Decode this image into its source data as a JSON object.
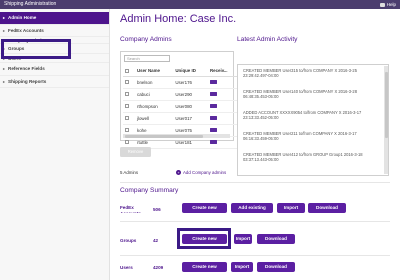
{
  "topbar": {
    "title": "Shipping Administration",
    "help": "Help"
  },
  "sidebar": {
    "items": [
      {
        "label": "Admin Home"
      },
      {
        "label": "FedEx Accounts"
      },
      {
        "label": "Company Admins"
      },
      {
        "label": "Groups"
      },
      {
        "label": "Users"
      },
      {
        "label": "Reference Fields"
      },
      {
        "label": "Shipping Reports"
      }
    ]
  },
  "page": {
    "title": "Admin Home: Case Inc."
  },
  "admins": {
    "heading": "Company Admins",
    "search_placeholder": "Search",
    "columns": [
      "User Name",
      "Unique ID",
      "Receiv..."
    ],
    "rows": [
      {
        "name": "bnelson",
        "id": "User176"
      },
      {
        "name": "cabuci",
        "id": "User290"
      },
      {
        "name": "rthompson",
        "id": "User080"
      },
      {
        "name": "jlowell",
        "id": "User017"
      },
      {
        "name": "kohe",
        "id": "User075"
      },
      {
        "name": "rtuttle",
        "id": "User181"
      }
    ],
    "remove_label": "Remove",
    "count_label": "5 Admins",
    "add_label": "Add Company admins"
  },
  "activity": {
    "heading": "Latest Admin Activity",
    "entries": [
      "CREATED MEMBER User315 to/from COMPANY X 2016-3-25 23:29:42.497-04:00",
      "CREATED MEMBER User140 to/from COMPANY X 2016-3-28 06:48:35.453-05:00",
      "ADDED ACCOUNT XXXXX9054 to/from COMPANY X 2016-3-17 23:13:33.452-05:00",
      "CREATED MEMBER User211 to/from COMPANY X 2016-3-17 06:16:33.459-05:00",
      "CREATED MEMBER User412 to/from GROUP Group1 2016-3-18 03:37:13.443-05:00"
    ]
  },
  "summary": {
    "heading": "Company Summary",
    "rows": [
      {
        "label": "FedEx Accounts",
        "count": "506",
        "buttons": [
          "Create new",
          "Add existing",
          "Import",
          "Download"
        ]
      },
      {
        "label": "Groups",
        "count": "42",
        "buttons": [
          "Create new",
          "Import",
          "Download"
        ]
      },
      {
        "label": "Users",
        "count": "4209",
        "buttons": [
          "Create new",
          "Import",
          "Download"
        ]
      }
    ]
  },
  "colors": {
    "brand_purple": "#4d148c",
    "button_purple": "#5b1fa2",
    "topbar": "#4b3d6e",
    "highlight": "#3b1a86"
  }
}
